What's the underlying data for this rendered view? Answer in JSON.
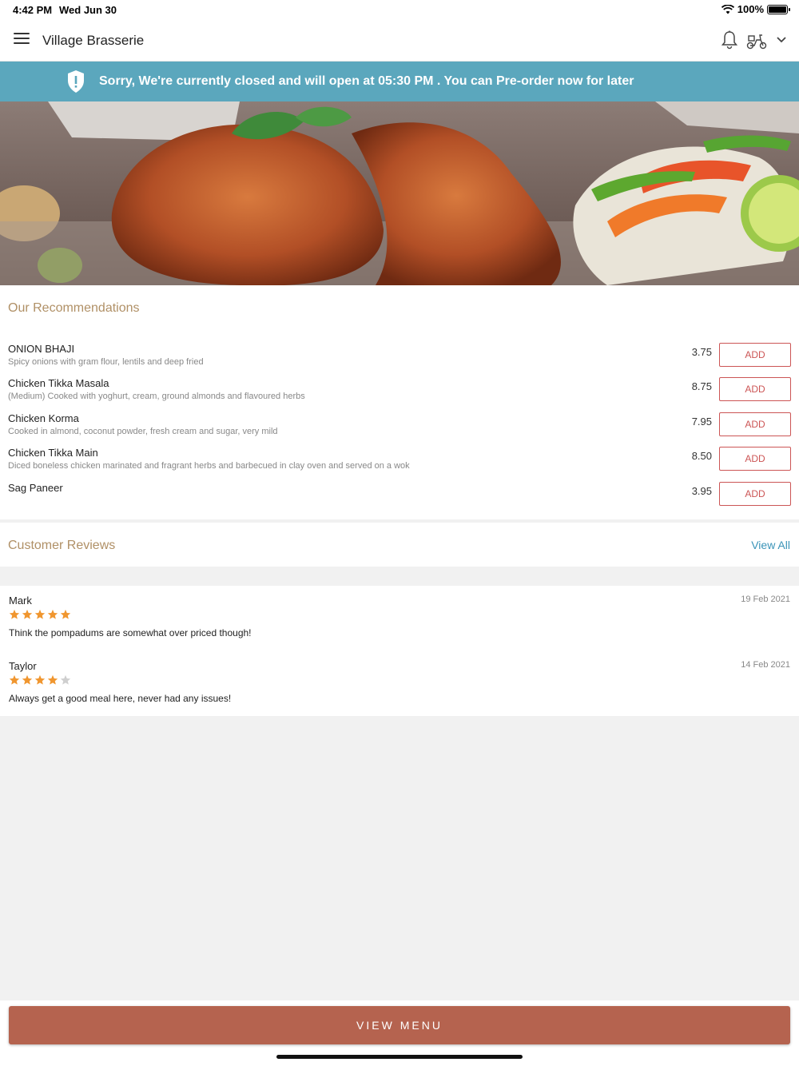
{
  "status": {
    "time": "4:42 PM",
    "date": "Wed Jun 30",
    "battery": "100%"
  },
  "app": {
    "title": "Village Brasserie"
  },
  "banner": {
    "message": "Sorry, We're currently closed and will open at 05:30 PM . You can Pre-order now for later"
  },
  "recommendations": {
    "title": "Our Recommendations",
    "add_label": "ADD",
    "items": [
      {
        "name": "ONION BHAJI",
        "desc": "Spicy onions with gram flour, lentils and deep fried",
        "price": "3.75"
      },
      {
        "name": "Chicken Tikka Masala",
        "desc": "(Medium) Cooked with yoghurt, cream, ground almonds and flavoured herbs",
        "price": "8.75"
      },
      {
        "name": "Chicken Korma",
        "desc": "Cooked in almond, coconut powder, fresh cream and sugar, very mild",
        "price": "7.95"
      },
      {
        "name": "Chicken Tikka Main",
        "desc": "Diced boneless chicken marinated and fragrant herbs and barbecued in clay oven and served on a wok",
        "price": "8.50"
      },
      {
        "name": "Sag Paneer",
        "desc": "",
        "price": "3.95"
      }
    ]
  },
  "reviews": {
    "title": "Customer Reviews",
    "view_all": "View All",
    "items": [
      {
        "name": "Mark",
        "date": "19 Feb 2021",
        "rating": 5,
        "text": "Think the pompadums are somewhat over priced though!"
      },
      {
        "name": "Taylor",
        "date": "14 Feb 2021",
        "rating": 4,
        "text": "Always get a good meal here, never had any issues!"
      }
    ]
  },
  "footer": {
    "view_menu": "VIEW MENU"
  },
  "colors": {
    "accent": "#b5634f",
    "banner": "#5ba7bd",
    "section_title": "#b09066",
    "link": "#3b94b8",
    "star": "#f0962f"
  }
}
